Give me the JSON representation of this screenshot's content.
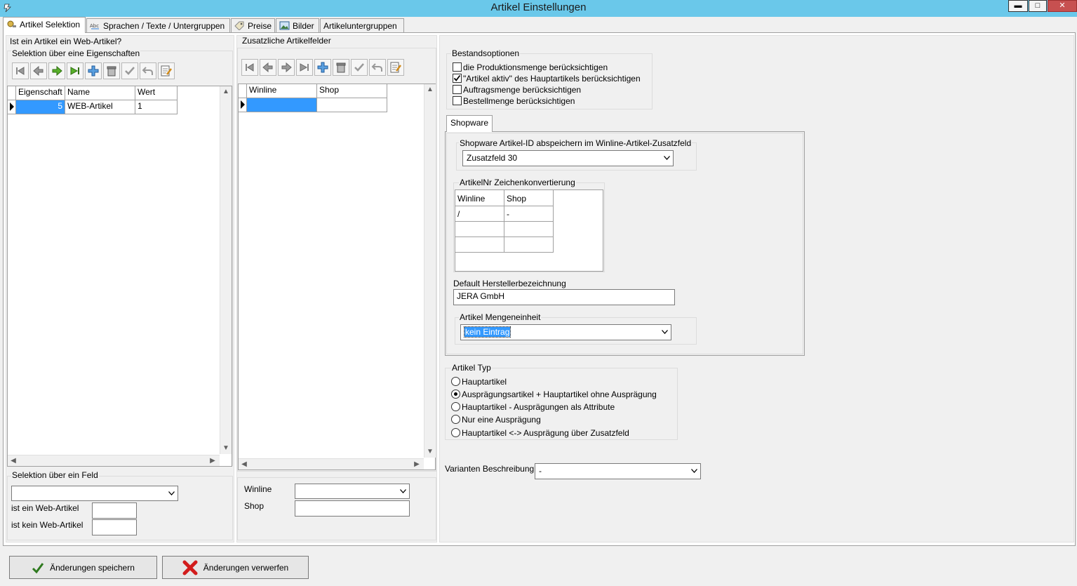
{
  "window": {
    "title": "Artikel Einstellungen",
    "controls": {
      "minimize": "▬",
      "maximize": "□",
      "close": "✕"
    }
  },
  "tabs": [
    {
      "label": "Artikel Selektion",
      "icon": "settings-icon",
      "active": true
    },
    {
      "label": "Sprachen / Texte / Untergruppen",
      "icon": "text-abc-icon"
    },
    {
      "label": "Preise",
      "icon": "price-tag-icon"
    },
    {
      "label": "Bilder",
      "icon": "picture-icon"
    },
    {
      "label": "Artikeluntergruppen"
    }
  ],
  "left": {
    "question": "Ist ein Artikel ein Web-Artikel?",
    "selection_props_title": "Selektion über eine Eigenschaften",
    "grid": {
      "columns": [
        "Eigenschaft",
        "Name",
        "Wert"
      ],
      "rows": [
        {
          "eigenschaft": "5",
          "name": "WEB-Artikel",
          "wert": "1"
        }
      ]
    },
    "field_selection": {
      "title": "Selektion über ein Feld",
      "select_value": "",
      "is_web_label": "ist ein Web-Artikel",
      "is_web_value": "",
      "not_web_label": "ist kein Web-Artikel",
      "not_web_value": ""
    }
  },
  "middle": {
    "title": "Zusatzliche Artikelfelder",
    "grid": {
      "columns": [
        "Winline",
        "Shop"
      ],
      "rows": [
        {
          "winline": "",
          "shop": ""
        }
      ]
    },
    "winline_label": "Winline",
    "winline_value": "",
    "shop_label": "Shop",
    "shop_value": ""
  },
  "right": {
    "stock_title": "Bestandsoptionen",
    "stock_options": [
      {
        "label": "die Produktionsmenge berücksichtigen",
        "checked": false
      },
      {
        "label": "\"Artikel aktiv\" des Hauptartikels berücksichtigen",
        "checked": true
      },
      {
        "label": "Auftragsmenge berücksichtigen",
        "checked": false
      },
      {
        "label": "Bestellmenge berücksichtigen",
        "checked": false
      }
    ],
    "shopware_tab": "Shopware",
    "id_field_label": "Shopware Artikel-ID abspeichern im Winline-Artikel-Zusatzfeld",
    "id_field_value": "Zusatzfeld 30",
    "conv_title": "ArtikelNr Zeichenkonvertierung",
    "conv_columns": [
      "Winline",
      "Shop"
    ],
    "conv_rows": [
      {
        "winline": "/",
        "shop": "-"
      },
      {
        "winline": "",
        "shop": ""
      },
      {
        "winline": "",
        "shop": ""
      }
    ],
    "manufacturer_label": "Default Herstellerbezeichnung",
    "manufacturer_value": "JERA GmbH",
    "unit_label": "Artikel Mengeneinheit",
    "unit_value": "kein Eintrag",
    "type_title": "Artikel Typ",
    "type_options": [
      {
        "label": "Hauptartikel",
        "selected": false
      },
      {
        "label": "Ausprägungsartikel + Hauptartikel ohne Ausprägung",
        "selected": true
      },
      {
        "label": "Hauptartikel - Ausprägungen als Attribute",
        "selected": false
      },
      {
        "label": "Nur eine Ausprägung",
        "selected": false
      },
      {
        "label": "Hauptartikel <-> Ausprägung über Zusatzfeld",
        "selected": false
      }
    ],
    "variants_label": "Varianten Beschreibung",
    "variants_value": "-"
  },
  "footer": {
    "save_label": "Änderungen speichern",
    "discard_label": "Änderungen verwerfen"
  },
  "colors": {
    "titlebar": "#6ac8ea",
    "selection": "#3399ff",
    "close_red": "#c75050"
  }
}
